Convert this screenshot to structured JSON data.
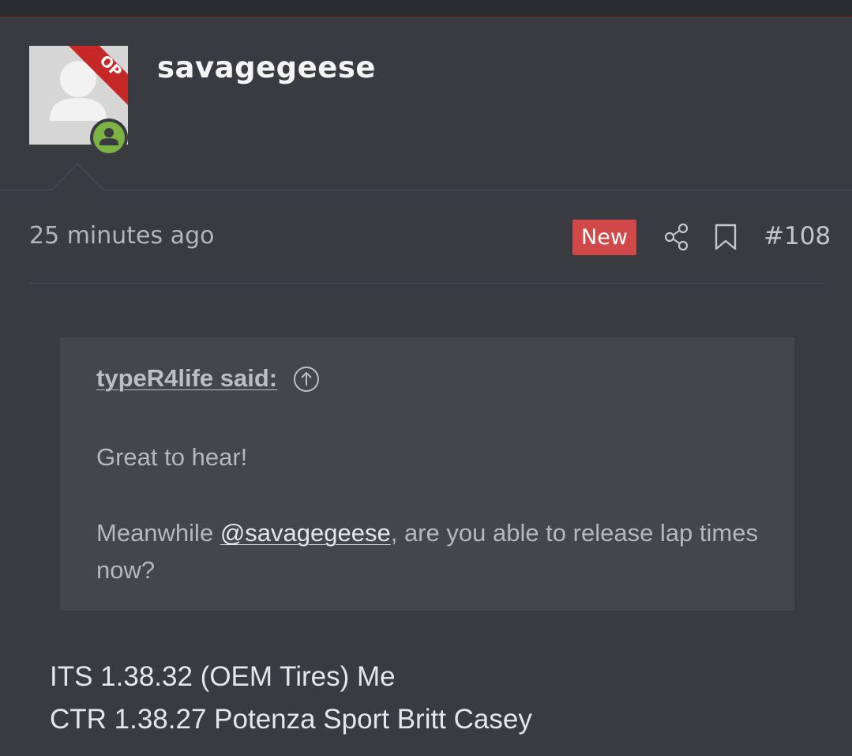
{
  "post": {
    "author": {
      "username": "savagegeese",
      "op_label": "OP",
      "avatar_icon": "default-user-avatar",
      "status_icon": "online-user-icon"
    },
    "meta": {
      "timestamp": "25 minutes ago",
      "new_badge": "New",
      "share_icon": "share-icon",
      "bookmark_icon": "bookmark-icon",
      "post_number": "#108"
    },
    "quote": {
      "author_label": "typeR4life said:",
      "jump_icon": "arrow-up-circle-icon",
      "line1": "Great to hear!",
      "line2_before": "Meanwhile ",
      "mention": "@savagegeese",
      "line2_after": ", are you able to release lap times now?"
    },
    "body": {
      "lines": [
        "ITS 1.38.32 (OEM Tires) Me",
        "CTR 1.38.27 Potenza Sport Britt Casey"
      ]
    }
  },
  "colors": {
    "background": "#3a3b41",
    "quote_background": "#45464c",
    "new_badge": "#d04848",
    "op_ribbon": "#c62828",
    "online_green": "#7cb342"
  }
}
